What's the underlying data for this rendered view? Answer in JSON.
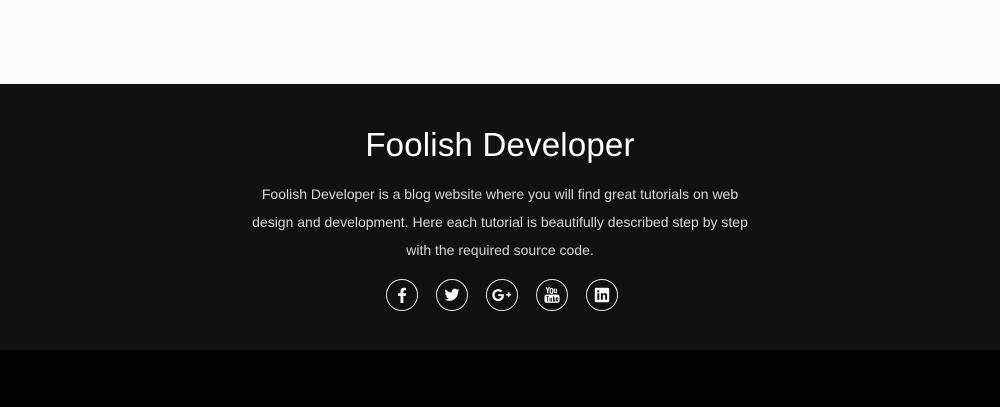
{
  "footer": {
    "title": "Foolish Developer",
    "description": "Foolish Developer is a blog website where you will find great tutorials on web design and development. Here each tutorial is beautifully described step by step with the required source code.",
    "social_icons": [
      "facebook-icon",
      "twitter-icon",
      "google-plus-icon",
      "youtube-icon",
      "linkedin-icon"
    ]
  },
  "colors": {
    "top_background": "#fcfcfc",
    "footer_background": "#111111",
    "bottom_bar": "#020202",
    "text": "#ffffff"
  }
}
